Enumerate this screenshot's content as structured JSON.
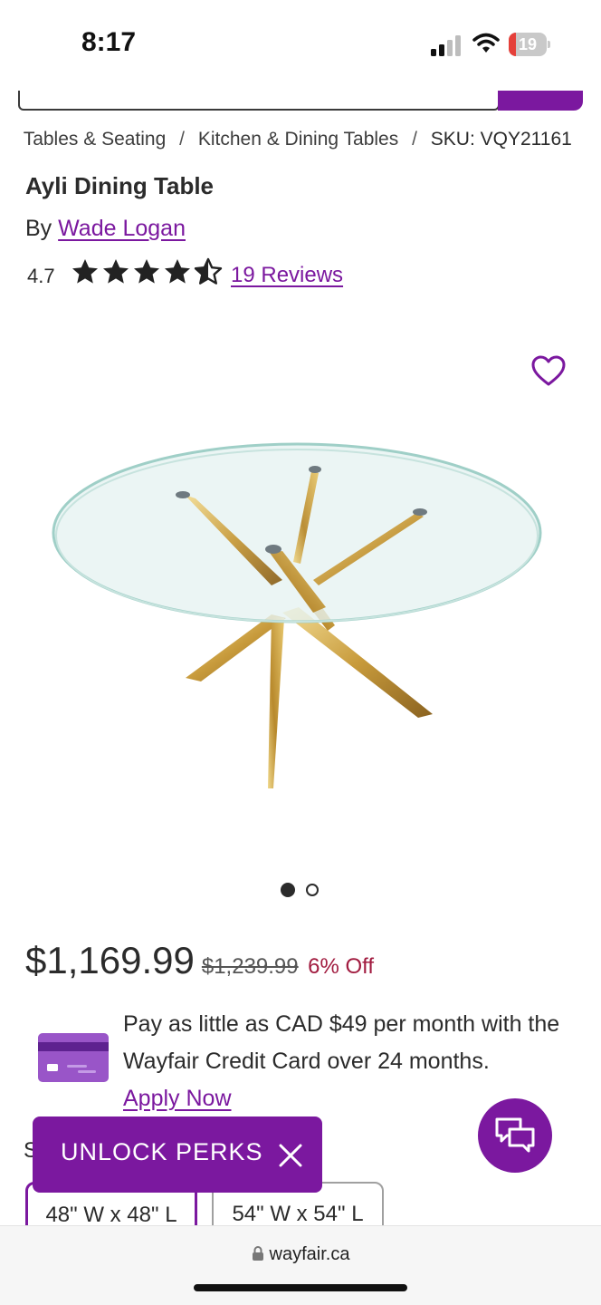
{
  "status_bar": {
    "time": "8:17",
    "battery_level": "19",
    "battery_fraction": 0.19,
    "icons": [
      "cellular-signal-icon",
      "wifi-icon",
      "battery-icon"
    ]
  },
  "breadcrumb": {
    "items": [
      "Tables & Seating",
      "Kitchen & Dining Tables"
    ],
    "separator": "/",
    "sku": "SKU: VQY21161"
  },
  "product": {
    "title": "Ayli Dining Table",
    "by_prefix": "By",
    "brand": "Wade Logan",
    "rating": "4.7",
    "rating_value": 4.7,
    "reviews_label": "19 Reviews",
    "image_count": 2,
    "active_image": 1
  },
  "pricing": {
    "price": "$1,169.99",
    "original_price": "$1,239.99",
    "discount": "6% Off"
  },
  "financing": {
    "text": "Pay as little as CAD $49 per month with the Wayfair Credit Card over 24 months.",
    "link": "Apply Now"
  },
  "sizes": {
    "label_partial": "S",
    "options": [
      "48\" W x 48\" L",
      "54\" W x 54\" L"
    ],
    "selected": 0
  },
  "perks_banner": {
    "label": "UNLOCK PERKS"
  },
  "browser": {
    "url": "wayfair.ca"
  },
  "colors": {
    "brand_purple": "#7b189f",
    "discount_red": "#a11b3f",
    "text": "#2b2b2b"
  }
}
